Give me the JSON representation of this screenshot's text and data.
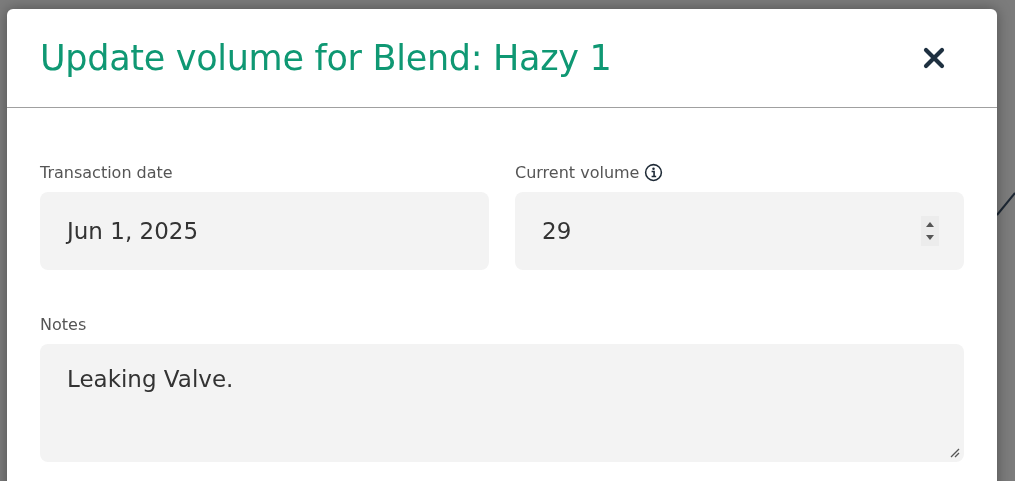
{
  "dialog": {
    "title": "Update volume for Blend: Hazy 1",
    "fields": [
      {
        "kind": "date",
        "label": "Transaction date",
        "value": "Jun 1, 2025"
      },
      {
        "kind": "number",
        "label": "Current volume",
        "value": "29"
      }
    ],
    "notes": {
      "label": "Notes",
      "value": "Leaking Valve."
    }
  }
}
